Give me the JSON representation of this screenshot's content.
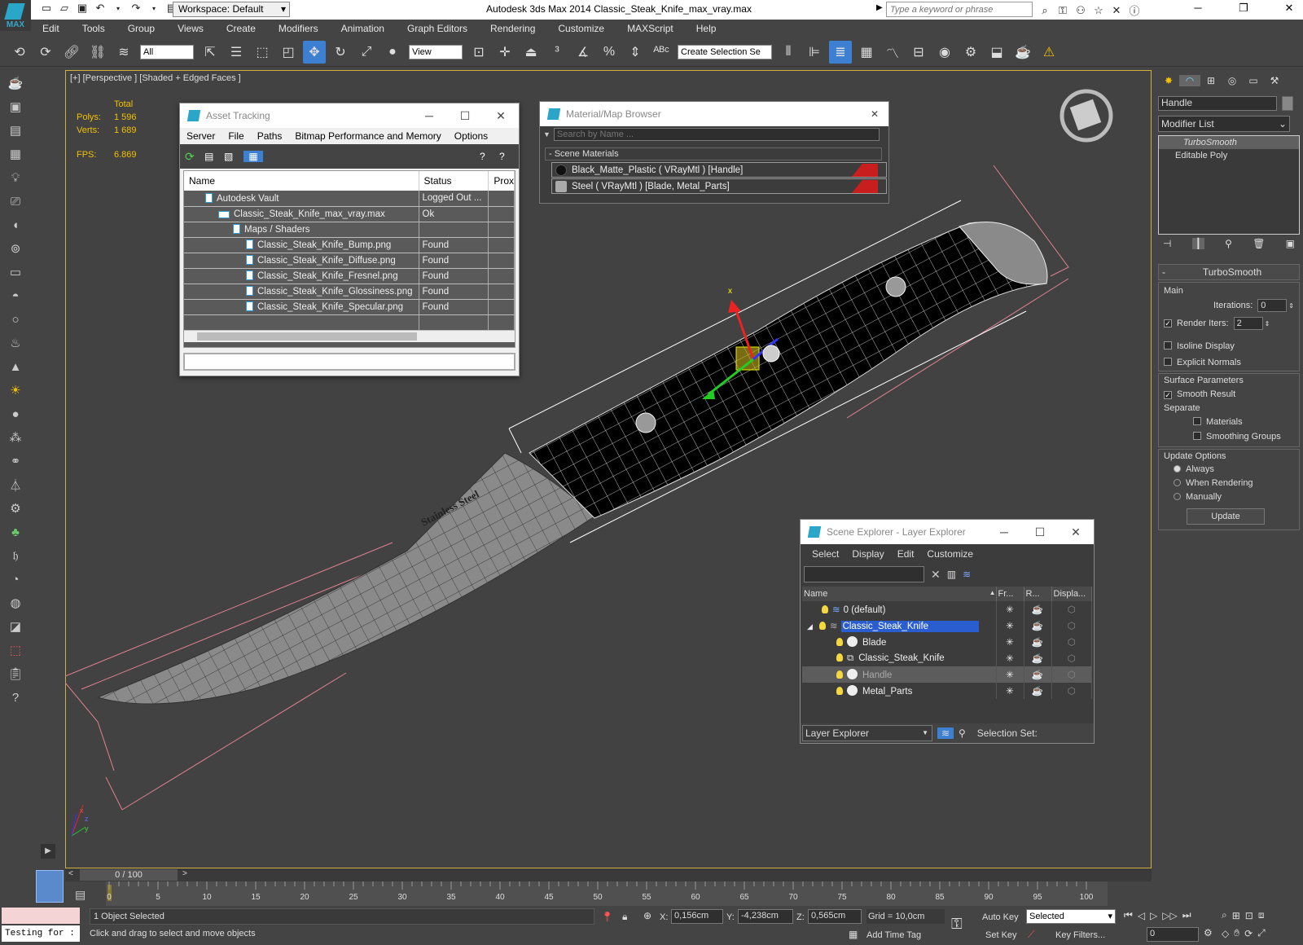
{
  "app": {
    "title": "Autodesk 3ds Max  2014     Classic_Steak_Knife_max_vray.max",
    "logo": "MAX",
    "workspace": "Workspace: Default",
    "search_placeholder": "Type a keyword or phrase"
  },
  "menu": [
    "Edit",
    "Tools",
    "Group",
    "Views",
    "Create",
    "Modifiers",
    "Animation",
    "Graph Editors",
    "Rendering",
    "Customize",
    "MAXScript",
    "Help"
  ],
  "toolbar": {
    "filter": "All",
    "view": "View",
    "selection_set": "Create Selection Se"
  },
  "viewport": {
    "label": "[+] [Perspective ] [Shaded + Edged Faces ]",
    "stats_total": "Total",
    "polys_label": "Polys:",
    "polys": "1 596",
    "verts_label": "Verts:",
    "verts": "1 689",
    "fps_label": "FPS:",
    "fps": "6.869",
    "blade_text": "Stainless Steel",
    "axis_x": "x",
    "axis_y": "y",
    "axis_z": "z"
  },
  "asset_tracking": {
    "title": "Asset Tracking",
    "menu": [
      "Server",
      "File",
      "Paths",
      "Bitmap Performance and Memory",
      "Options"
    ],
    "columns": [
      "Name",
      "Status",
      "Prox"
    ],
    "rows": [
      {
        "name": "Autodesk Vault",
        "status": "Logged Out ...",
        "indent": 1
      },
      {
        "name": "Classic_Steak_Knife_max_vray.max",
        "status": "Ok",
        "indent": 2
      },
      {
        "name": "Maps / Shaders",
        "status": "",
        "indent": 3
      },
      {
        "name": "Classic_Steak_Knife_Bump.png",
        "status": "Found",
        "indent": 4
      },
      {
        "name": "Classic_Steak_Knife_Diffuse.png",
        "status": "Found",
        "indent": 4
      },
      {
        "name": "Classic_Steak_Knife_Fresnel.png",
        "status": "Found",
        "indent": 4
      },
      {
        "name": "Classic_Steak_Knife_Glossiness.png",
        "status": "Found",
        "indent": 4
      },
      {
        "name": "Classic_Steak_Knife_Specular.png",
        "status": "Found",
        "indent": 4
      }
    ]
  },
  "material_browser": {
    "title": "Material/Map Browser",
    "search": "Search by Name ...",
    "section": "- Scene Materials",
    "materials": [
      "Black_Matte_Plastic  ( VRayMtl )  [Handle]",
      "Steel  ( VRayMtl )  [Blade, Metal_Parts]"
    ]
  },
  "scene_explorer": {
    "title": "Scene Explorer - Layer Explorer",
    "menu": [
      "Select",
      "Display",
      "Edit",
      "Customize"
    ],
    "columns": [
      "Name",
      "Fr...",
      "R...",
      "Displa..."
    ],
    "rows": [
      {
        "name": "0 (default)",
        "level": 0,
        "type": "layer"
      },
      {
        "name": "Classic_Steak_Knife",
        "level": 0,
        "type": "layer",
        "selected": true
      },
      {
        "name": "Blade",
        "level": 1,
        "type": "obj"
      },
      {
        "name": "Classic_Steak_Knife",
        "level": 1,
        "type": "grp"
      },
      {
        "name": "Handle",
        "level": 1,
        "type": "obj",
        "hl": true
      },
      {
        "name": "Metal_Parts",
        "level": 1,
        "type": "obj"
      }
    ],
    "footer_dropdown": "Layer Explorer",
    "selection_set": "Selection Set:"
  },
  "command_panel": {
    "object_name": "Handle",
    "modifier_list": "Modifier List",
    "stack": [
      "TurboSmooth",
      "Editable Poly"
    ],
    "rollout": "TurboSmooth",
    "main": "Main",
    "iterations_label": "Iterations:",
    "iterations": "0",
    "render_iters_label": "Render Iters:",
    "render_iters": "2",
    "isoline": "Isoline Display",
    "explicit": "Explicit Normals",
    "surface": "Surface Parameters",
    "smooth": "Smooth Result",
    "separate": "Separate",
    "materials": "Materials",
    "smoothing_groups": "Smoothing Groups",
    "update_options": "Update Options",
    "always": "Always",
    "when_rendering": "When Rendering",
    "manually": "Manually",
    "update": "Update"
  },
  "timeline": {
    "frame": "0 / 100",
    "ticks": [
      "0",
      "5",
      "10",
      "15",
      "20",
      "25",
      "30",
      "35",
      "40",
      "45",
      "50",
      "55",
      "60",
      "65",
      "70",
      "75",
      "80",
      "85",
      "90",
      "95",
      "100"
    ]
  },
  "status": {
    "listener": "Testing for :",
    "selected": "1 Object Selected",
    "prompt": "Click and drag to select and move objects",
    "x_label": "X:",
    "x": "0,156cm",
    "y_label": "Y:",
    "y": "-4,238cm",
    "z_label": "Z:",
    "z": "0,565cm",
    "grid": "Grid = 10,0cm",
    "add_time_tag": "Add Time Tag",
    "auto_key": "Auto Key",
    "set_key": "Set Key",
    "key_mode": "Selected",
    "key_filters": "Key Filters...",
    "frame_field": "0"
  }
}
